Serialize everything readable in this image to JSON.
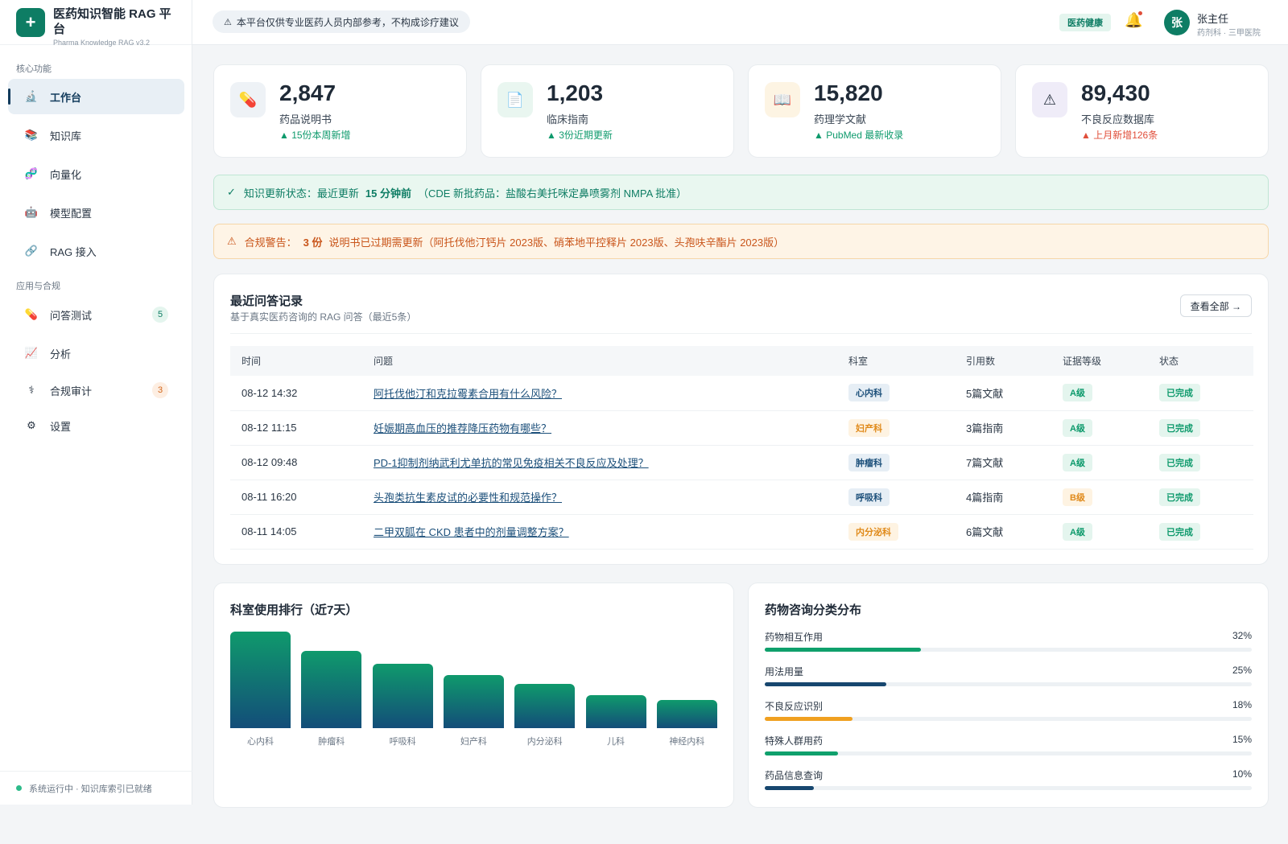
{
  "brand": {
    "logo": "+",
    "title": "医药知识智能 RAG 平台",
    "subtitle": "Pharma Knowledge RAG v3.2"
  },
  "sidebar": {
    "section_core": "核心功能",
    "section_apps": "应用与合规",
    "items": [
      {
        "label": "工作台",
        "icon": "🔬",
        "icon_name": "microscope-icon",
        "active": true
      },
      {
        "label": "知识库",
        "icon": "📚",
        "icon_name": "books-icon"
      },
      {
        "label": "向量化",
        "icon": "🧬",
        "icon_name": "dna-icon"
      },
      {
        "label": "模型配置",
        "icon": "🤖",
        "icon_name": "robot-icon"
      },
      {
        "label": "RAG 接入",
        "icon": "🔗",
        "icon_name": "link-icon"
      },
      {
        "label": "问答测试",
        "icon": "💊",
        "icon_name": "pill-icon",
        "badge": "5"
      },
      {
        "label": "分析",
        "icon": "📈",
        "icon_name": "chart-icon"
      },
      {
        "label": "合规审计",
        "icon": "⚕",
        "icon_name": "caduceus-icon",
        "badge": "3"
      },
      {
        "label": "设置",
        "icon": "⚙",
        "icon_name": "gear-icon"
      }
    ],
    "footer": "系统运行中 · 知识库索引已就绪"
  },
  "topbar": {
    "notice": "本平台仅供专业医药人员内部参考，不构成诊疗建议",
    "tag": "医药健康",
    "user": {
      "avatar": "张",
      "name": "张主任",
      "dept": "药剂科 · 三甲医院"
    }
  },
  "stats": [
    {
      "value": "2,847",
      "label": "药品说明书",
      "trend": "▲ 15份本周新增",
      "icon": "💊",
      "icon_name": "pill-icon",
      "color": "#0e9a6c",
      "bg": "#eef2f6"
    },
    {
      "value": "1,203",
      "label": "临床指南",
      "trend": "▲ 3份近期更新",
      "icon": "📄",
      "icon_name": "document-icon",
      "color": "#0e9a6c",
      "bg": "#e9f6f0"
    },
    {
      "value": "15,820",
      "label": "药理学文献",
      "trend": "▲ PubMed 最新收录",
      "icon": "📖",
      "icon_name": "book-icon",
      "color": "#0e9a6c",
      "bg": "#fdf4e3"
    },
    {
      "value": "89,430",
      "label": "不良反应数据库",
      "trend": "▲ 上月新增126条",
      "icon": "⚠",
      "icon_name": "warning-icon",
      "color": "#e04e3a",
      "bg": "#efecf8"
    }
  ],
  "banners": {
    "update": {
      "icon": "✓",
      "prefix": "知识更新状态：最近更新",
      "highlight": "15 分钟前",
      "suffix": "（CDE 新批药品：盐酸右美托咪定鼻喷雾剂 NMPA 批准）"
    },
    "compliance": {
      "icon": "⚠",
      "prefix": "合规警告：",
      "highlight": "3 份",
      "suffix": "说明书已过期需更新（阿托伐他汀钙片 2023版、硝苯地平控释片 2023版、头孢呋辛酯片 2023版）"
    }
  },
  "qa": {
    "title": "最近问答记录",
    "subtitle": "基于真实医药咨询的 RAG 问答（最近5条）",
    "view_all": "查看全部 →",
    "columns": [
      "时间",
      "问题",
      "科室",
      "引用数",
      "证据等级",
      "状态"
    ],
    "rows": [
      {
        "time": "08-12 14:32",
        "question": "阿托伐他汀和克拉霉素合用有什么风险？",
        "dept": "心内科",
        "dept_style": "blue",
        "refs": "5篇文献",
        "level": "A级",
        "level_style": "green",
        "status": "已完成"
      },
      {
        "time": "08-12 11:15",
        "question": "妊娠期高血压的推荐降压药物有哪些？",
        "dept": "妇产科",
        "dept_style": "orange",
        "refs": "3篇指南",
        "level": "A级",
        "level_style": "green",
        "status": "已完成"
      },
      {
        "time": "08-12 09:48",
        "question": "PD-1抑制剂纳武利尤单抗的常见免疫相关不良反应及处理？",
        "dept": "肿瘤科",
        "dept_style": "blue",
        "refs": "7篇文献",
        "level": "A级",
        "level_style": "green",
        "status": "已完成"
      },
      {
        "time": "08-11 16:20",
        "question": "头孢类抗生素皮试的必要性和规范操作？",
        "dept": "呼吸科",
        "dept_style": "blue",
        "refs": "4篇指南",
        "level": "B级",
        "level_style": "orange",
        "status": "已完成"
      },
      {
        "time": "08-11 14:05",
        "question": "二甲双胍在 CKD 患者中的剂量调整方案？",
        "dept": "内分泌科",
        "dept_style": "orange",
        "refs": "6篇文献",
        "level": "A级",
        "level_style": "green",
        "status": "已完成"
      }
    ]
  },
  "chart_data": {
    "type": "bar",
    "title": "科室使用排行（近7天）",
    "categories": [
      "心内科",
      "肿瘤科",
      "呼吸科",
      "妇产科",
      "内分泌科",
      "儿科",
      "神经内科"
    ],
    "values": [
      100,
      80,
      67,
      55,
      46,
      34,
      29
    ],
    "ylim": [
      0,
      100
    ],
    "colors": [
      "#0f9a6c",
      "#134d79"
    ]
  },
  "distribution": {
    "title": "药物咨询分类分布",
    "items": [
      {
        "label": "药物相互作用",
        "pct": "32%",
        "value": 32,
        "color": "#0fa06c"
      },
      {
        "label": "用法用量",
        "pct": "25%",
        "value": 25,
        "color": "#17476f"
      },
      {
        "label": "不良反应识别",
        "pct": "18%",
        "value": 18,
        "color": "#f0a020"
      },
      {
        "label": "特殊人群用药",
        "pct": "15%",
        "value": 15,
        "color": "#0fa06c"
      },
      {
        "label": "药品信息查询",
        "pct": "10%",
        "value": 10,
        "color": "#17476f"
      }
    ]
  }
}
